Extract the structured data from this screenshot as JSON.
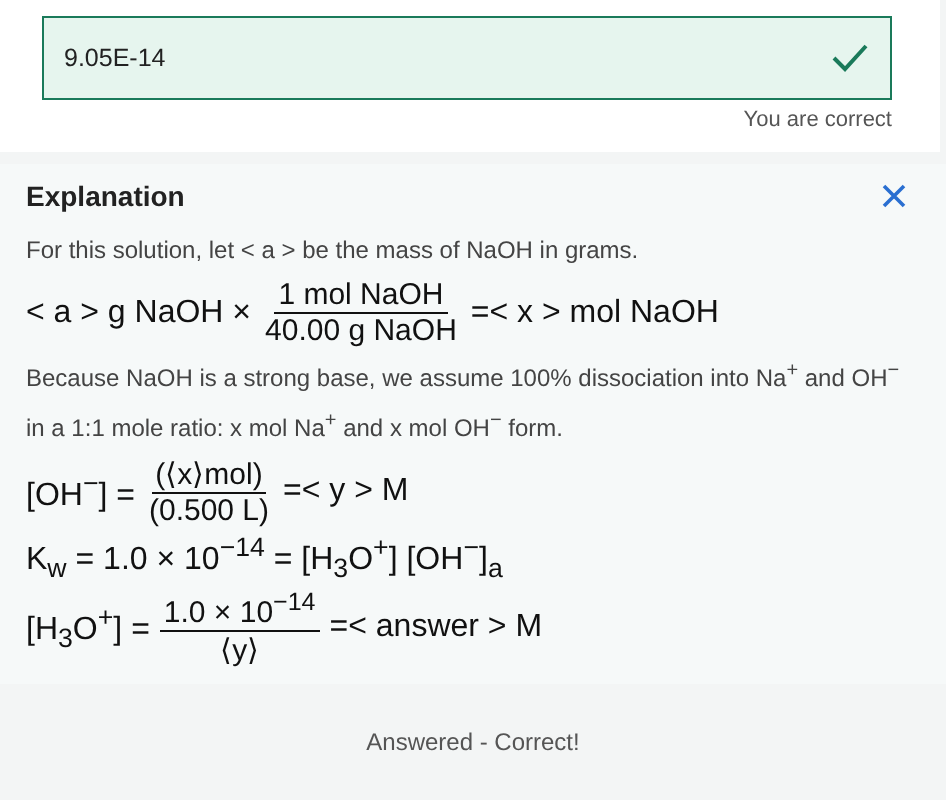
{
  "answer": {
    "value": "9.05E-14",
    "correct": true
  },
  "feedback": "You are correct",
  "explanation": {
    "title": "Explanation",
    "lines": [
      {
        "kind": "para",
        "text": "For this solution, let < a > be the mass of NaOH in grams."
      },
      {
        "kind": "equation",
        "parts": [
          {
            "kind": "text",
            "text": "< a > g NaOH ×"
          },
          {
            "kind": "frac",
            "num": "1 mol NaOH",
            "den": "40.00  g NaOH"
          },
          {
            "kind": "text",
            "text": "=< x > mol NaOH"
          }
        ]
      },
      {
        "kind": "para",
        "text": "Because NaOH is a strong base, we assume 100% dissociation into Na$^{+}$ and OH$^{−}$ in a 1:1 mole ratio: x mol Na$^{+}$ and x mol OH$^{−}$ form."
      },
      {
        "kind": "equation",
        "parts": [
          {
            "kind": "text",
            "text": "[OH$^{−}$] ="
          },
          {
            "kind": "frac",
            "num": "(⟨x⟩mol)",
            "den": "(0.500 L)"
          },
          {
            "kind": "text",
            "text": "=< y > M"
          }
        ]
      },
      {
        "kind": "equation",
        "parts": [
          {
            "kind": "text",
            "text": "K$_{w}$ = 1.0 × 10$^{−14}$ = [H$_{3}$O$^{+}$] [OH$^{−}$]$_{a}$"
          }
        ]
      },
      {
        "kind": "equation",
        "parts": [
          {
            "kind": "text",
            "text": "[H$_{3}$O$^{+}$] ="
          },
          {
            "kind": "frac",
            "num": "1.0 × 10$^{−14}$",
            "den": "⟨y⟩"
          },
          {
            "kind": "text",
            "text": "=< answer > M"
          }
        ]
      }
    ]
  },
  "footer": "Answered - Correct!"
}
